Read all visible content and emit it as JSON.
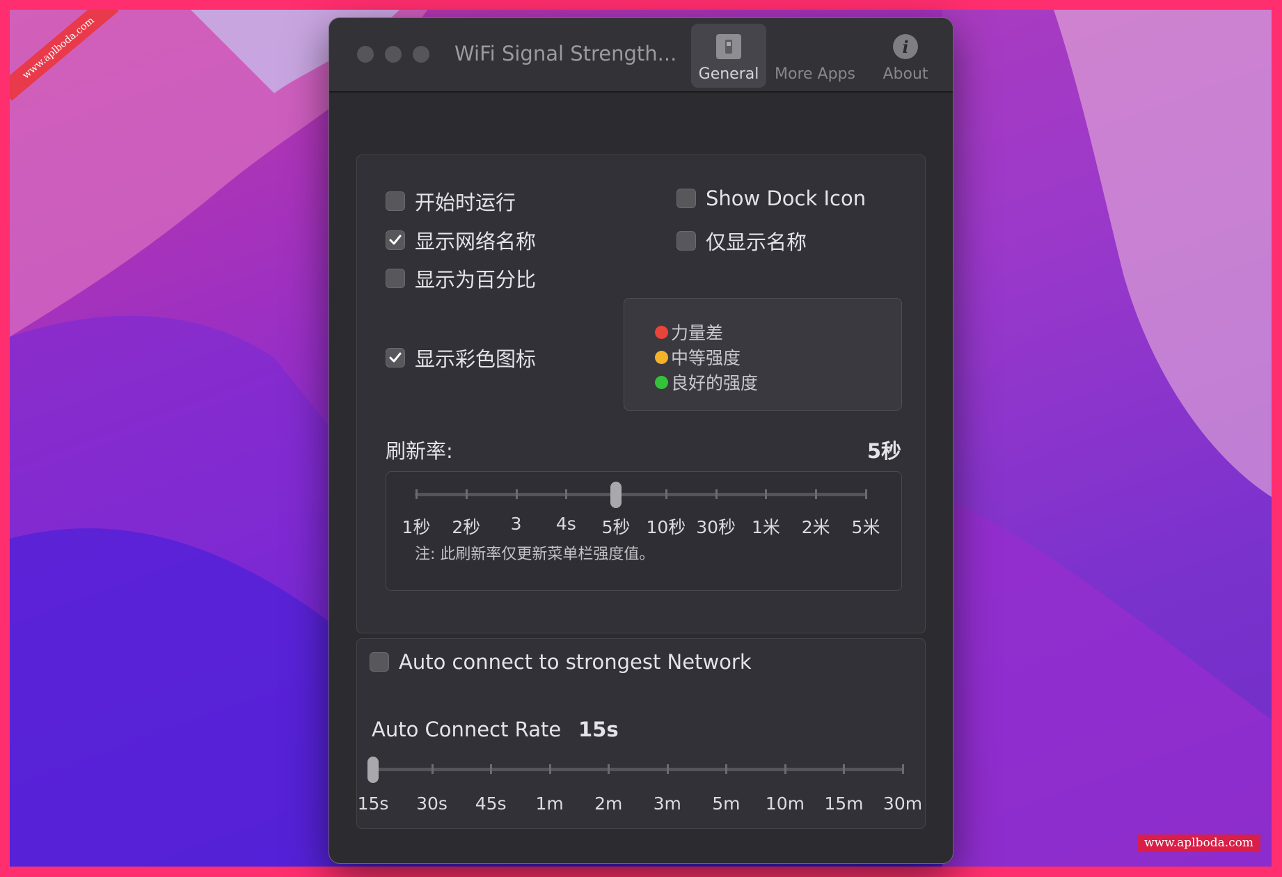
{
  "watermark": {
    "corner": "www.aplboda.com",
    "bottom_right": "www.aplboda.com"
  },
  "window": {
    "title": "WiFi Signal Strength...",
    "tabs": [
      {
        "label": "General",
        "icon": "switch-icon",
        "active": true
      },
      {
        "label": "More Apps",
        "icon": "apps-icon",
        "active": false
      },
      {
        "label": "About",
        "icon": "info-icon",
        "active": false
      }
    ]
  },
  "general": {
    "launch_at_start": {
      "label": "开始时运行",
      "checked": false
    },
    "show_dock_icon": {
      "label": "Show Dock Icon",
      "checked": false
    },
    "show_network_name": {
      "label": "显示网络名称",
      "checked": true
    },
    "show_name_only": {
      "label": "仅显示名称",
      "checked": false
    },
    "show_percentage": {
      "label": "显示为百分比",
      "checked": false
    },
    "show_color_icon": {
      "label": "显示彩色图标",
      "checked": true
    },
    "legend": [
      {
        "label": "力量差",
        "color": "#e8443a"
      },
      {
        "label": "中等强度",
        "color": "#f2b32a"
      },
      {
        "label": "良好的强度",
        "color": "#34c23a"
      }
    ],
    "refresh": {
      "label": "刷新率:",
      "value": "5秒",
      "ticks": [
        "1秒",
        "2秒",
        "3",
        "4s",
        "5秒",
        "10秒",
        "30秒",
        "1米",
        "2米",
        "5米"
      ],
      "selected_index": 4,
      "note": "注: 此刷新率仅更新菜单栏强度值。"
    }
  },
  "auto_connect": {
    "checkbox": {
      "label": "Auto connect to strongest Network",
      "checked": false
    },
    "rate_label": "Auto Connect Rate",
    "rate_value": "15s",
    "ticks": [
      "15s",
      "30s",
      "45s",
      "1m",
      "2m",
      "3m",
      "5m",
      "10m",
      "15m",
      "30m"
    ],
    "selected_index": 0
  }
}
